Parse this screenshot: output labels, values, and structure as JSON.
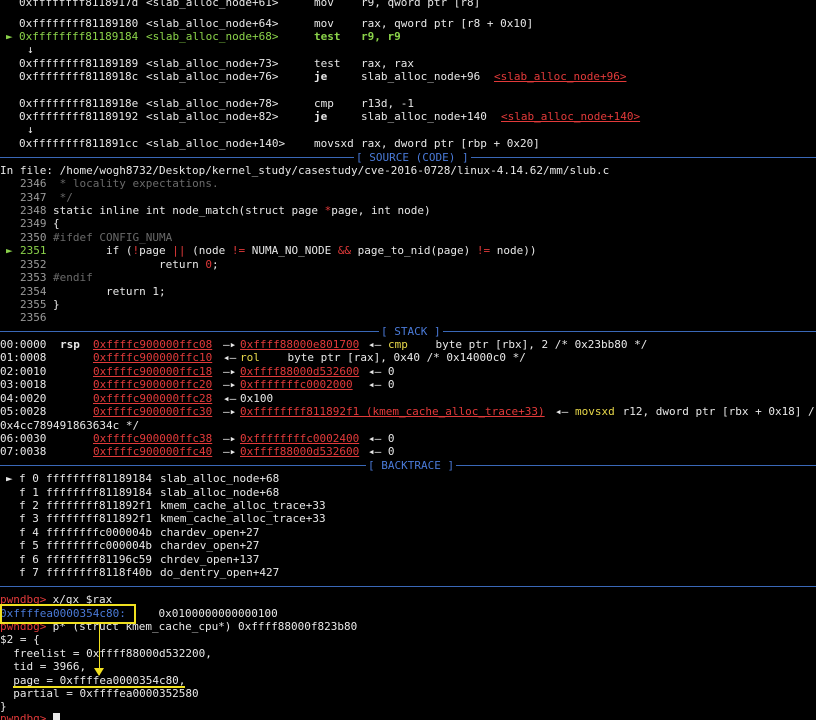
{
  "disasm": {
    "l1": {
      "arrow": "",
      "addr": "0xffffffff8118917d",
      "sym": "<slab_alloc_node+61>",
      "op": "mov",
      "args": "r9, qword ptr [r8]"
    },
    "l2": {
      "arrow": "",
      "addr": "0xffffffff81189180",
      "sym": "<slab_alloc_node+64>",
      "op": "mov",
      "args": "rax, qword ptr [r8 + 0x10]"
    },
    "l3": {
      "arrow": "►",
      "addr": "0xffffffff81189184",
      "sym": "<slab_alloc_node+68>",
      "op": "test",
      "args": "r9, r9"
    },
    "d1": "↓",
    "l4": {
      "addr": "0xffffffff81189189",
      "sym": "<slab_alloc_node+73>",
      "op": "test",
      "args": "rax, rax"
    },
    "l5": {
      "addr": "0xffffffff8118918c",
      "sym": "<slab_alloc_node+76>",
      "op": "je",
      "args": "slab_alloc_node+96 ",
      "target": "<slab_alloc_node+96>"
    },
    "l6": {
      "addr": "0xffffffff8118918e",
      "sym": "<slab_alloc_node+78>",
      "op": "cmp",
      "args": "r13d, -1"
    },
    "l7": {
      "addr": "0xffffffff81189192",
      "sym": "<slab_alloc_node+82>",
      "op": "je",
      "args": "slab_alloc_node+140 ",
      "target": "<slab_alloc_node+140>"
    },
    "d2": "↓",
    "l8": {
      "addr": "0xffffffff811891cc",
      "sym": "<slab_alloc_node+140>",
      "op": "movsxd",
      "args": "rax, dword ptr [rbp + 0x20]"
    }
  },
  "source": {
    "header": "[ SOURCE (CODE) ]",
    "file_line": "In file: /home/wogh8732/Desktop/kernel_study/casestudy/cve-2016-0728/linux-4.14.62/mm/slub.c",
    "lines": [
      {
        "no": "2346",
        "text": " * locality expectations."
      },
      {
        "no": "2347",
        "text": " */"
      },
      {
        "no": "2348",
        "a": "static inline ",
        "b": "int",
        "c": " node_match(",
        "d": "struct",
        "e": " page ",
        "f": "*",
        "g": "page, ",
        "h": "int",
        "i": " node)"
      },
      {
        "no": "2349",
        "text": "{"
      },
      {
        "no": "2350",
        "text": "#ifdef CONFIG_NUMA"
      },
      {
        "no": "2351",
        "marker": "►",
        "a": "        if (",
        "b": "!",
        "c": "page ",
        "d": "||",
        "e": " (node ",
        "f": "!=",
        "g": " NUMA_NO_NODE ",
        "h": "&&",
        "i": " page_to_nid(page) ",
        "j": "!=",
        "k": " node))"
      },
      {
        "no": "2352",
        "a": "                return ",
        "b": "0",
        "c": ";"
      },
      {
        "no": "2353",
        "text": "#endif"
      },
      {
        "no": "2354",
        "a": "        return ",
        "b": "1",
        "c": ";"
      },
      {
        "no": "2355",
        "text": "}"
      },
      {
        "no": "2356",
        "text": ""
      }
    ]
  },
  "stack": {
    "header": "[ STACK ]",
    "rows": [
      {
        "idx": "00:0000",
        "reg": "rsp",
        "addr": "0xffffc900000ffc08",
        "ptr": "0xffff88000e801700",
        "arrow2": "◂—",
        "op": "cmp",
        "rest": "    byte ptr [rbx], 2 /* 0x23bb80 */"
      },
      {
        "idx": "01:0008",
        "addr": "0xffffc900000ffc10",
        "op": "rol",
        "rest": "    byte ptr [rax], 0x40 /* 0x14000c0 */"
      },
      {
        "idx": "02:0010",
        "addr": "0xffffc900000ffc18",
        "ptr": "0xffff88000d532600",
        "tail": "◂— 0"
      },
      {
        "idx": "03:0018",
        "addr": "0xffffc900000ffc20",
        "ptr": "0xfffffffc0002000",
        "tail": "◂— 0"
      },
      {
        "idx": "04:0020",
        "addr": "0xffffc900000ffc28",
        "val": "0x100"
      },
      {
        "idx": "05:0028",
        "addr": "0xffffc900000ffc30",
        "ptr": "0xffffffff811892f1 (kmem_cache_alloc_trace+33)",
        "arrow2": "◂—",
        "op": "movsxd",
        "rest": " r12, dword ptr [rbx + 0x18] /",
        "wrap": "0x4cc789491863634c */"
      },
      {
        "idx": "06:0030",
        "addr": "0xffffc900000ffc38",
        "ptr": "0xffffffffc0002400",
        "tail": "◂— 0"
      },
      {
        "idx": "07:0038",
        "addr": "0xffffc900000ffc40",
        "ptr": "0xffff88000d532600",
        "tail": "◂— 0"
      }
    ]
  },
  "backtrace": {
    "header": "[ BACKTRACE ]",
    "frames": [
      {
        "marker": "►",
        "f": "f 0",
        "addr": "ffffffff81189184",
        "sym": "slab_alloc_node+68"
      },
      {
        "f": "f 1",
        "addr": "ffffffff81189184",
        "sym": "slab_alloc_node+68"
      },
      {
        "f": "f 2",
        "addr": "ffffffff811892f1",
        "sym": "kmem_cache_alloc_trace+33"
      },
      {
        "f": "f 3",
        "addr": "ffffffff811892f1",
        "sym": "kmem_cache_alloc_trace+33"
      },
      {
        "f": "f 4",
        "addr": "ffffffffc000004b",
        "sym": "chardev_open+27"
      },
      {
        "f": "f 5",
        "addr": "ffffffffc000004b",
        "sym": "chardev_open+27"
      },
      {
        "f": "f 6",
        "addr": "ffffffff81196c59",
        "sym": "chrdev_open+137"
      },
      {
        "f": "f 7",
        "addr": "ffffffff8118f40b",
        "sym": "do_dentry_open+427"
      }
    ]
  },
  "console": {
    "prompt": "pwndbg>",
    "cmd1": " x/gx $rax",
    "out_addr": "0xffffea0000354c80:",
    "out_val": "    0x0100000000000100",
    "cmd2": " p* (struct kmem_cache_cpu*) 0xffff88000f823b80",
    "r0": "$2 = {",
    "r1": "  freelist = 0xffff88000d532200,",
    "r2": "  tid = 3966,",
    "r3": "  page = 0xffffea0000354c80,",
    "r4": "  partial = 0xffffea0000352580",
    "r5": "}",
    "prompt2": "pwndbg>"
  },
  "colors": {
    "prompt": "#e23a3a",
    "accent": "#4a7ad8",
    "highlight": "#f0e020",
    "current": "#8bd34a"
  }
}
